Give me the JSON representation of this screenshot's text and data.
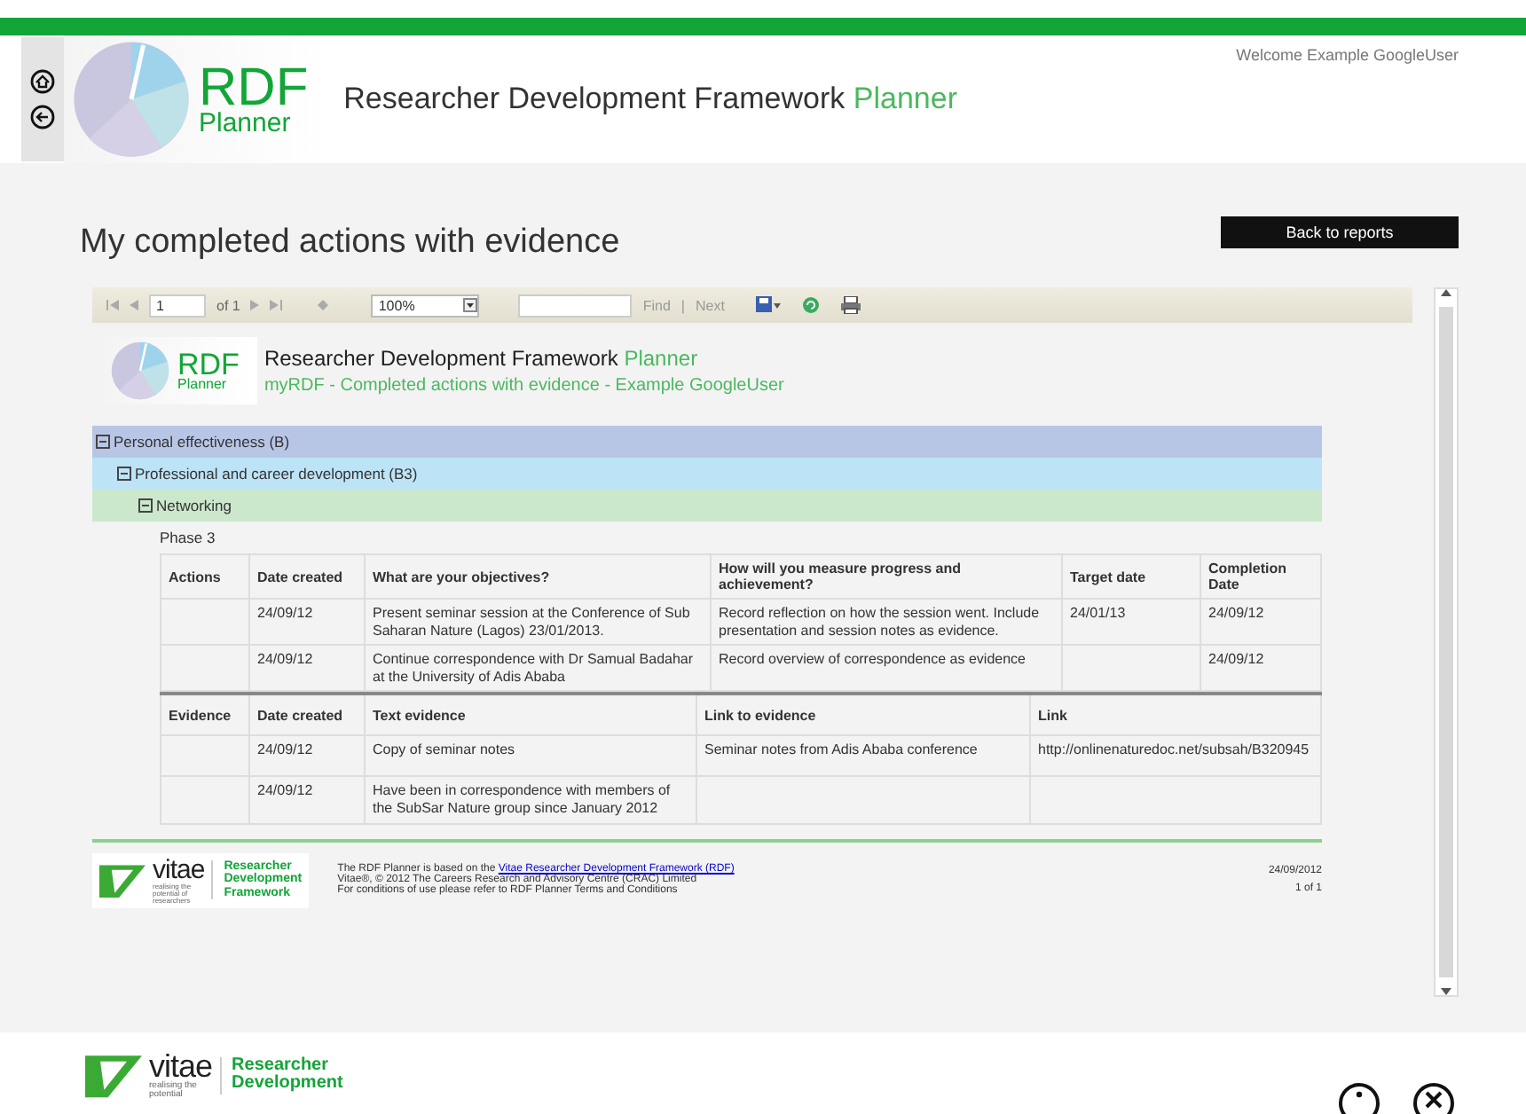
{
  "header": {
    "logo": {
      "main": "RDF",
      "sub": "Planner"
    },
    "title": "Researcher Development Framework",
    "title_accent": "Planner",
    "welcome": "Welcome Example GoogleUser"
  },
  "page_title": "My completed actions with evidence",
  "back_button": "Back to reports",
  "toolbar": {
    "page": "1",
    "of": "of 1",
    "zoom": "100%",
    "find": "Find",
    "separator": "|",
    "next": "Next"
  },
  "report": {
    "logo": {
      "main": "RDF",
      "sub": "Planner"
    },
    "title": "Researcher Development Framework",
    "title_accent": "Planner",
    "subtitle": "myRDF - Completed actions with evidence - Example GoogleUser",
    "groups": [
      {
        "label": "Personal effectiveness (B)",
        "expanded": true,
        "children": [
          {
            "label": "Professional and career development (B3)",
            "expanded": true,
            "children": [
              {
                "label": "Networking",
                "expanded": true,
                "phase": "Phase 3",
                "actions": {
                  "columns": [
                    "Actions",
                    "Date created",
                    "What are your objectives?",
                    "How will you measure progress and achievement?",
                    "Target date",
                    "Completion Date"
                  ],
                  "rows": [
                    [
                      "",
                      "24/09/12",
                      "Present seminar session at the Conference of Sub Saharan Nature (Lagos) 23/01/2013.",
                      "Record reflection on how the session went. Include presentation and session notes as evidence.",
                      "24/01/13",
                      "24/09/12"
                    ],
                    [
                      "",
                      "24/09/12",
                      "Continue correspondence with Dr Samual Badahar at the University of Adis Ababa",
                      "Record overview of correspondence as evidence",
                      "",
                      "24/09/12"
                    ]
                  ]
                },
                "evidence": {
                  "columns": [
                    "Evidence",
                    "Date created",
                    "Text evidence",
                    "Link to evidence",
                    "Link"
                  ],
                  "rows": [
                    [
                      "",
                      "24/09/12",
                      "Copy of seminar notes",
                      "Seminar notes from Adis Ababa conference",
                      "http://onlinenaturedoc.net/subsah/B320945"
                    ],
                    [
                      "",
                      "24/09/12",
                      "Have been in correspondence with members of the SubSar Nature group since January 2012",
                      "",
                      ""
                    ]
                  ]
                }
              }
            ]
          }
        ]
      }
    ],
    "footer": {
      "logo_word": "vitae",
      "logo_tag": "realising the potential of researchers",
      "logo_lines": [
        "Researcher",
        "Development",
        "Framework"
      ],
      "notice_before": "The RDF Planner is based on the",
      "notice_link": "Vitae Researcher Development Framework (RDF)",
      "notice_lines": [
        "Vitae®, © 2012 The Careers Research and Advisory Centre (CRAC) Limited",
        "For conditions of use please refer to RDF Planner Terms and Conditions"
      ],
      "date": "24/09/2012",
      "pages": "1 of 1"
    }
  },
  "page_footer": {
    "logo_word": "vitae",
    "logo_tag": "realising the potential",
    "logo_lines": [
      "Researcher",
      "Development"
    ]
  }
}
